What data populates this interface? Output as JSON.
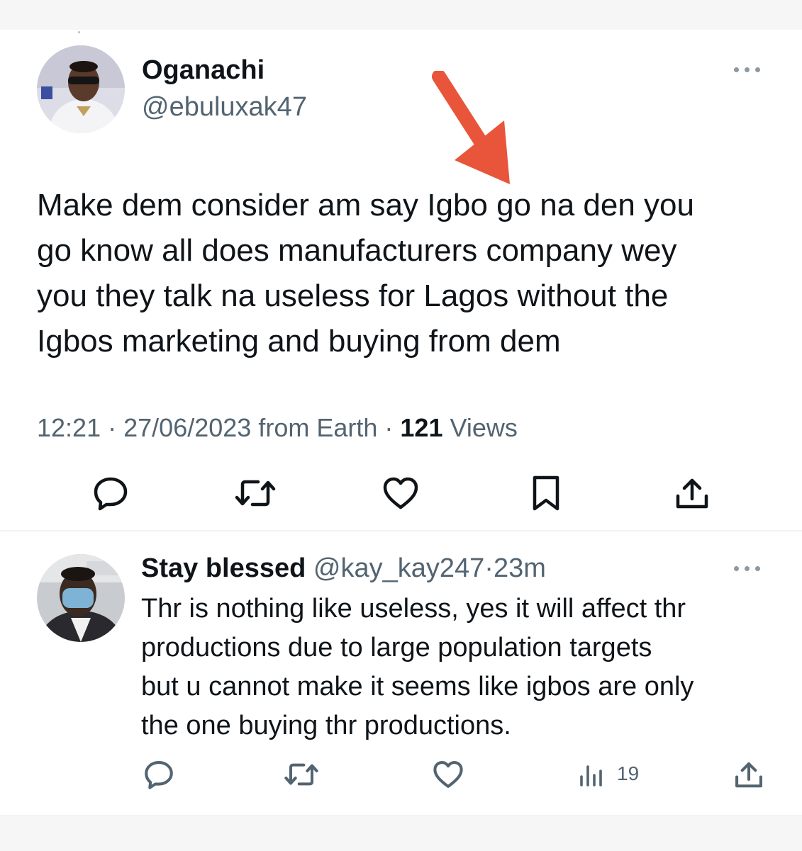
{
  "main_tweet": {
    "author_name": "Oganachi",
    "author_handle": "@ebuluxak47",
    "text": "Make dem consider am say Igbo go na den you\ngo know all does manufacturers company wey\nyou they talk na useless for Lagos without the\nIgbos marketing and buying from dem",
    "time": "12:21",
    "date": "27/06/2023",
    "source": "from Earth",
    "views_count": "121",
    "views_label": "Views",
    "separator": "·"
  },
  "reply": {
    "author_name": "Stay blessed",
    "author_handle": "@kay_kay247",
    "time_ago": "23m",
    "separator": "·",
    "text": "Thr is nothing like useless, yes it will affect thr\nproductions due to large population targets\nbut u cannot make it seems like igbos are only\nthe one buying thr productions.",
    "views": "19"
  },
  "icons": {
    "reply": "reply-icon",
    "retweet": "retweet-icon",
    "like": "heart-icon",
    "bookmark": "bookmark-icon",
    "share": "share-icon",
    "views": "views-icon",
    "more": "more-icon"
  },
  "colors": {
    "text_primary": "#0f1419",
    "text_secondary": "#536471",
    "annotation_arrow": "#e8553a",
    "divider": "#eff3f4"
  }
}
